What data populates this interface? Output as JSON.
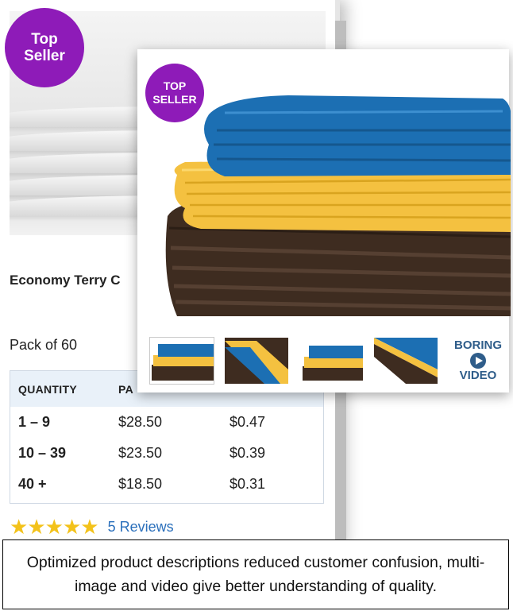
{
  "back_card": {
    "badge": {
      "line1": "Top",
      "line2": "Seller"
    },
    "product_title": "Economy Terry C",
    "pack_label": "Pack of 60",
    "price_table": {
      "headers": [
        "QUANTITY",
        "PA"
      ],
      "rows": [
        {
          "qty": "1 – 9",
          "pack_price": "$28.50",
          "unit_price": "$0.47"
        },
        {
          "qty": "10 – 39",
          "pack_price": "$23.50",
          "unit_price": "$0.39"
        },
        {
          "qty": "40 +",
          "pack_price": "$18.50",
          "unit_price": "$0.31"
        }
      ]
    },
    "rating": {
      "stars": 5,
      "reviews_label": "5 Reviews"
    }
  },
  "front_card": {
    "badge": {
      "line1": "TOP",
      "line2": "SELLER"
    },
    "video_button": {
      "line1": "BORING",
      "line2": "VIDEO"
    }
  },
  "caption": "Optimized product descriptions reduced customer confusion, multi-image and video give better understanding of quality.",
  "colors": {
    "badge": "#8e1bb8",
    "towel_blue": "#1f73b7",
    "towel_yellow": "#f5c443",
    "towel_brown": "#4a3527",
    "link": "#2a6fbb",
    "star": "#f3c21a",
    "video": "#2f5d8a"
  }
}
